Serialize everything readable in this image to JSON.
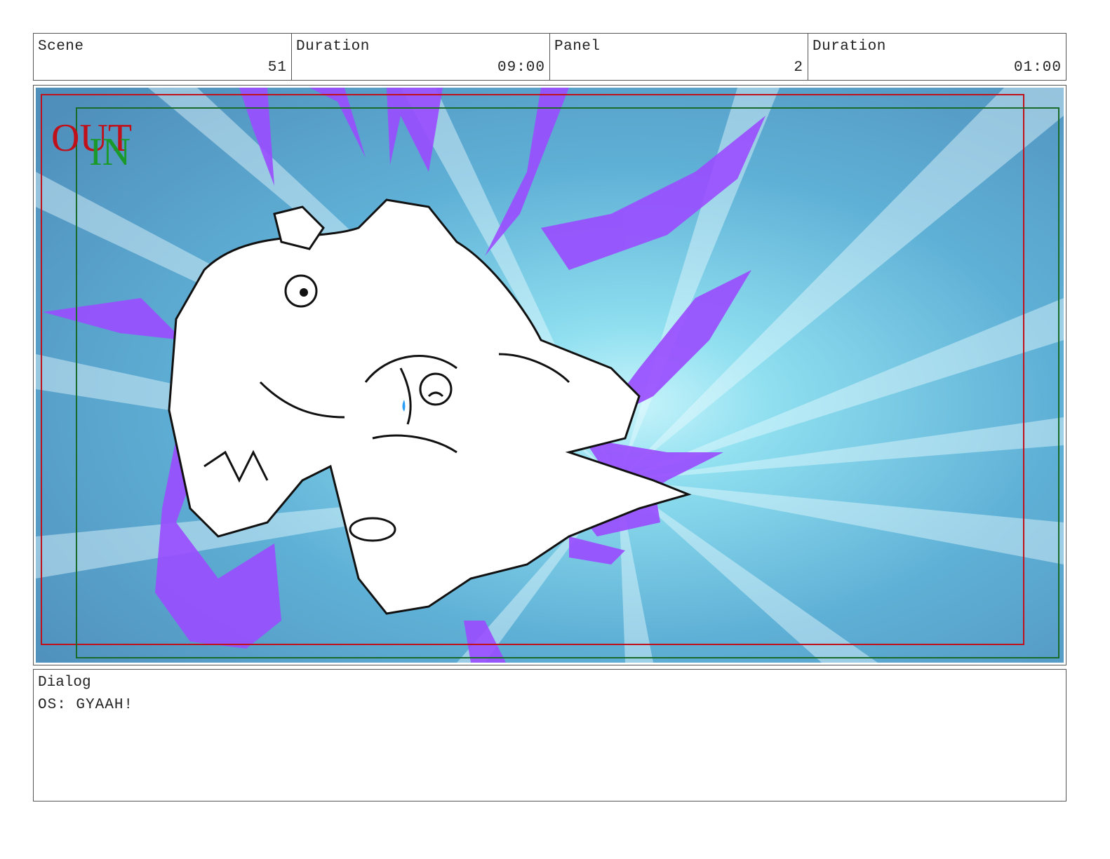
{
  "header": {
    "scene_label": "Scene",
    "scene_value": "51",
    "scene_duration_label": "Duration",
    "scene_duration_value": "09:00",
    "panel_label": "Panel",
    "panel_value": "2",
    "panel_duration_label": "Duration",
    "panel_duration_value": "01:00"
  },
  "panel": {
    "out_label": "OUT",
    "in_label": "IN",
    "out_color": "#c0101a",
    "in_color": "#1a9a2a",
    "background_color": "#6fb6d8",
    "splash_color": "#9a4cff"
  },
  "dialog": {
    "label": "Dialog",
    "text": "OS: GYAAH!"
  }
}
